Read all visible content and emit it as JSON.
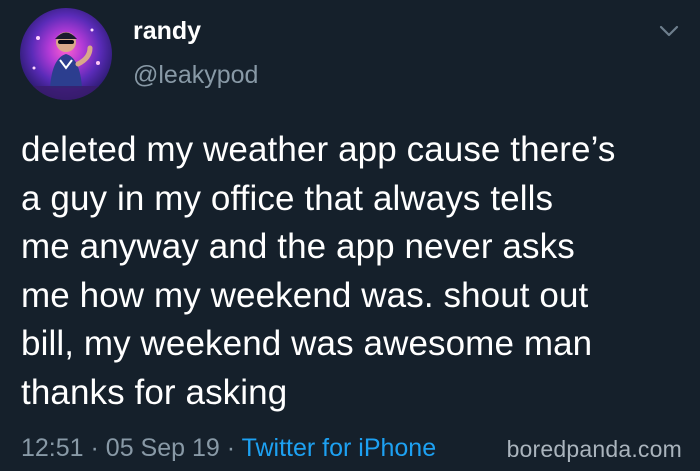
{
  "user": {
    "display_name": "randy",
    "handle": "@leakypod"
  },
  "tweet": {
    "text": "deleted my weather app cause there’s\na guy in my office that always tells\nme anyway and the app never asks\nme how my weekend was. shout out\nbill, my weekend was awesome man\nthanks for asking",
    "time": "12:51",
    "separator": "·",
    "date": "05 Sep 19",
    "source": "Twitter for iPhone"
  },
  "watermark": "boredpanda.com",
  "icons": {
    "menu": "chevron-down-icon",
    "avatar": "avatar"
  },
  "colors": {
    "background": "#15202b",
    "text": "#ffffff",
    "secondary": "#8899a6",
    "link": "#1da1f2"
  }
}
